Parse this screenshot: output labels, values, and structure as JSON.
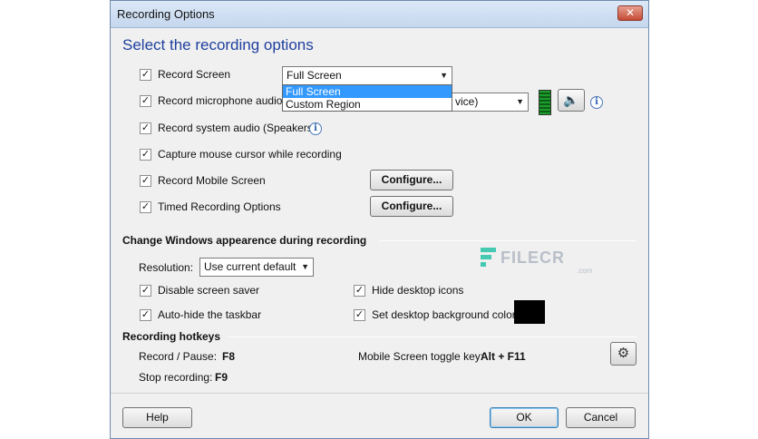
{
  "window": {
    "title": "Recording Options",
    "close_glyph": "✕"
  },
  "heading": "Select the recording options",
  "options": {
    "record_screen": {
      "label": "Record Screen",
      "checked": true
    },
    "record_screen_select": {
      "value": "Full Screen",
      "options": [
        "Full Screen",
        "Custom Region"
      ],
      "highlighted": "Full Screen"
    },
    "record_mic": {
      "label": "Record microphone audio",
      "checked": true
    },
    "mic_device_select": {
      "value_visible": "vice)"
    },
    "record_system_audio": {
      "label": "Record system audio (Speakers)",
      "checked": true
    },
    "capture_cursor": {
      "label": "Capture mouse cursor while recording",
      "checked": true
    },
    "record_mobile": {
      "label": "Record Mobile Screen",
      "checked": true,
      "button": "Configure..."
    },
    "timed_recording": {
      "label": "Timed Recording Options",
      "checked": true,
      "button": "Configure..."
    }
  },
  "appearance": {
    "section_title": "Change Windows appearence during recording",
    "resolution_label": "Resolution:",
    "resolution_value": "Use current default",
    "disable_screensaver": {
      "label": "Disable screen saver",
      "checked": true
    },
    "hide_icons": {
      "label": "Hide desktop icons",
      "checked": true
    },
    "autohide_taskbar": {
      "label": "Auto-hide the taskbar",
      "checked": true
    },
    "set_bg_color": {
      "label": "Set desktop background color:",
      "checked": true
    },
    "bg_color": "#000000"
  },
  "hotkeys": {
    "section_title": "Recording hotkeys",
    "record_pause_label": "Record / Pause:",
    "record_pause_key": "F8",
    "stop_label": "Stop recording:",
    "stop_key": "F9",
    "mobile_toggle_label": "Mobile Screen toggle key:",
    "mobile_toggle_key": "Alt + F11"
  },
  "footer": {
    "help": "Help",
    "ok": "OK",
    "cancel": "Cancel"
  },
  "watermark": {
    "text": "FILECR",
    "suffix": ".com"
  },
  "icons": {
    "check": "✓",
    "info": "i",
    "speaker": "🔈",
    "gear": "⚙",
    "dropdown_arrow": "▼"
  },
  "colors": {
    "heading": "#1f3f9e",
    "selection": "#3399ff",
    "meter": "#1c9e2c"
  }
}
